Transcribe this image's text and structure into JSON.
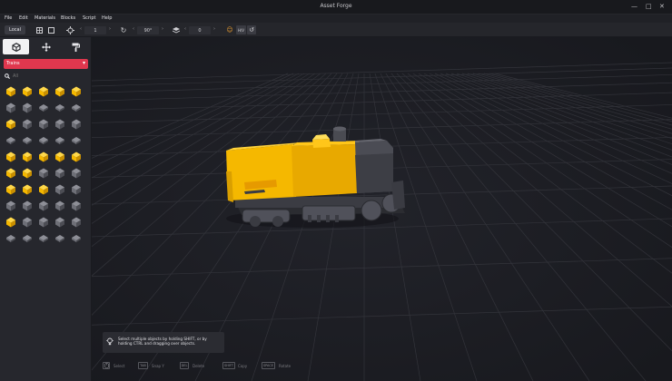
{
  "window": {
    "title": "Asset Forge",
    "minimize": "—",
    "maximize": "□",
    "close": "✕"
  },
  "menu": [
    "File",
    "Edit",
    "Materials",
    "Blocks",
    "Script",
    "Help"
  ],
  "toolbar": {
    "space_label": "Local",
    "move_step": "1",
    "rotate_step": "90°",
    "layer": "0",
    "flip_label": "H/V"
  },
  "sidebar": {
    "tabs": [
      {
        "name": "blocks",
        "icon": "cube-icon"
      },
      {
        "name": "transform",
        "icon": "move-icon"
      },
      {
        "name": "paint",
        "icon": "paint-roller-icon"
      }
    ],
    "category": "Trains",
    "search_placeholder": "All"
  },
  "hint": {
    "text": "Select multiple objects by holding SHIFT, or by holding CTRL and dragging over objects."
  },
  "shortcuts": [
    {
      "key": "LMB",
      "label": "Select"
    },
    {
      "key": "TAB",
      "label": "Snap Y"
    },
    {
      "key": "DEL",
      "label": "Delete"
    },
    {
      "key": "SHIFT",
      "label": "Copy"
    },
    {
      "key": "SPACE",
      "label": "Rotate"
    }
  ],
  "colors": {
    "accent": "#e0374e",
    "train_yellow": "#f5b800",
    "train_dark": "#3c3d44"
  }
}
